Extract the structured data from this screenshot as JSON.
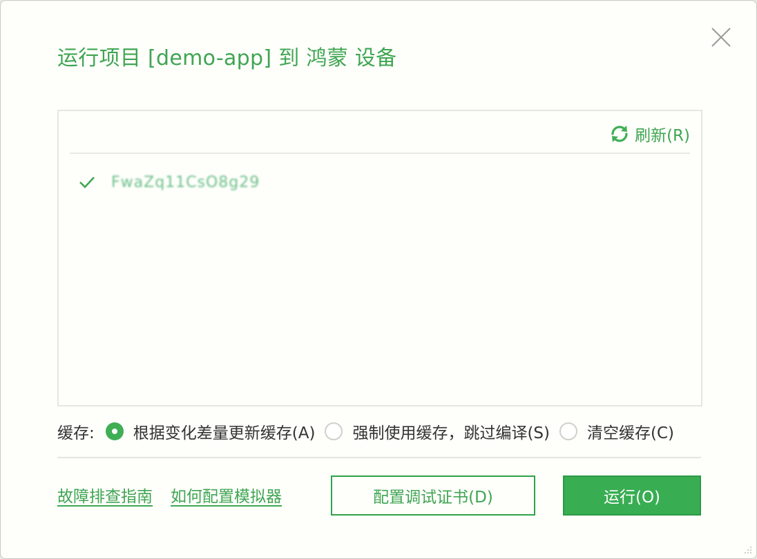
{
  "dialog": {
    "title": "运行项目 [demo-app] 到 鸿蒙 设备",
    "close_icon": "close-icon"
  },
  "devices": {
    "refresh_label": "刷新(R)",
    "refresh_icon": "refresh-icon",
    "items": [
      {
        "name": "FwaZq11CsO8g29",
        "selected": true,
        "check_icon": "check-icon"
      }
    ]
  },
  "cache": {
    "label": "缓存:",
    "options": [
      {
        "label": "根据变化差量更新缓存(A)",
        "checked": true
      },
      {
        "label": "强制使用缓存，跳过编译(S)",
        "checked": false
      },
      {
        "label": "清空缓存(C)",
        "checked": false
      }
    ]
  },
  "footer": {
    "link_troubleshoot": "故障排查指南",
    "link_emulator": "如何配置模拟器",
    "config_cert_button": "配置调试证书(D)",
    "run_button": "运行(O)"
  },
  "colors": {
    "accent": "#3fa552",
    "primary_button": "#38ad52",
    "background": "#fefefb"
  }
}
